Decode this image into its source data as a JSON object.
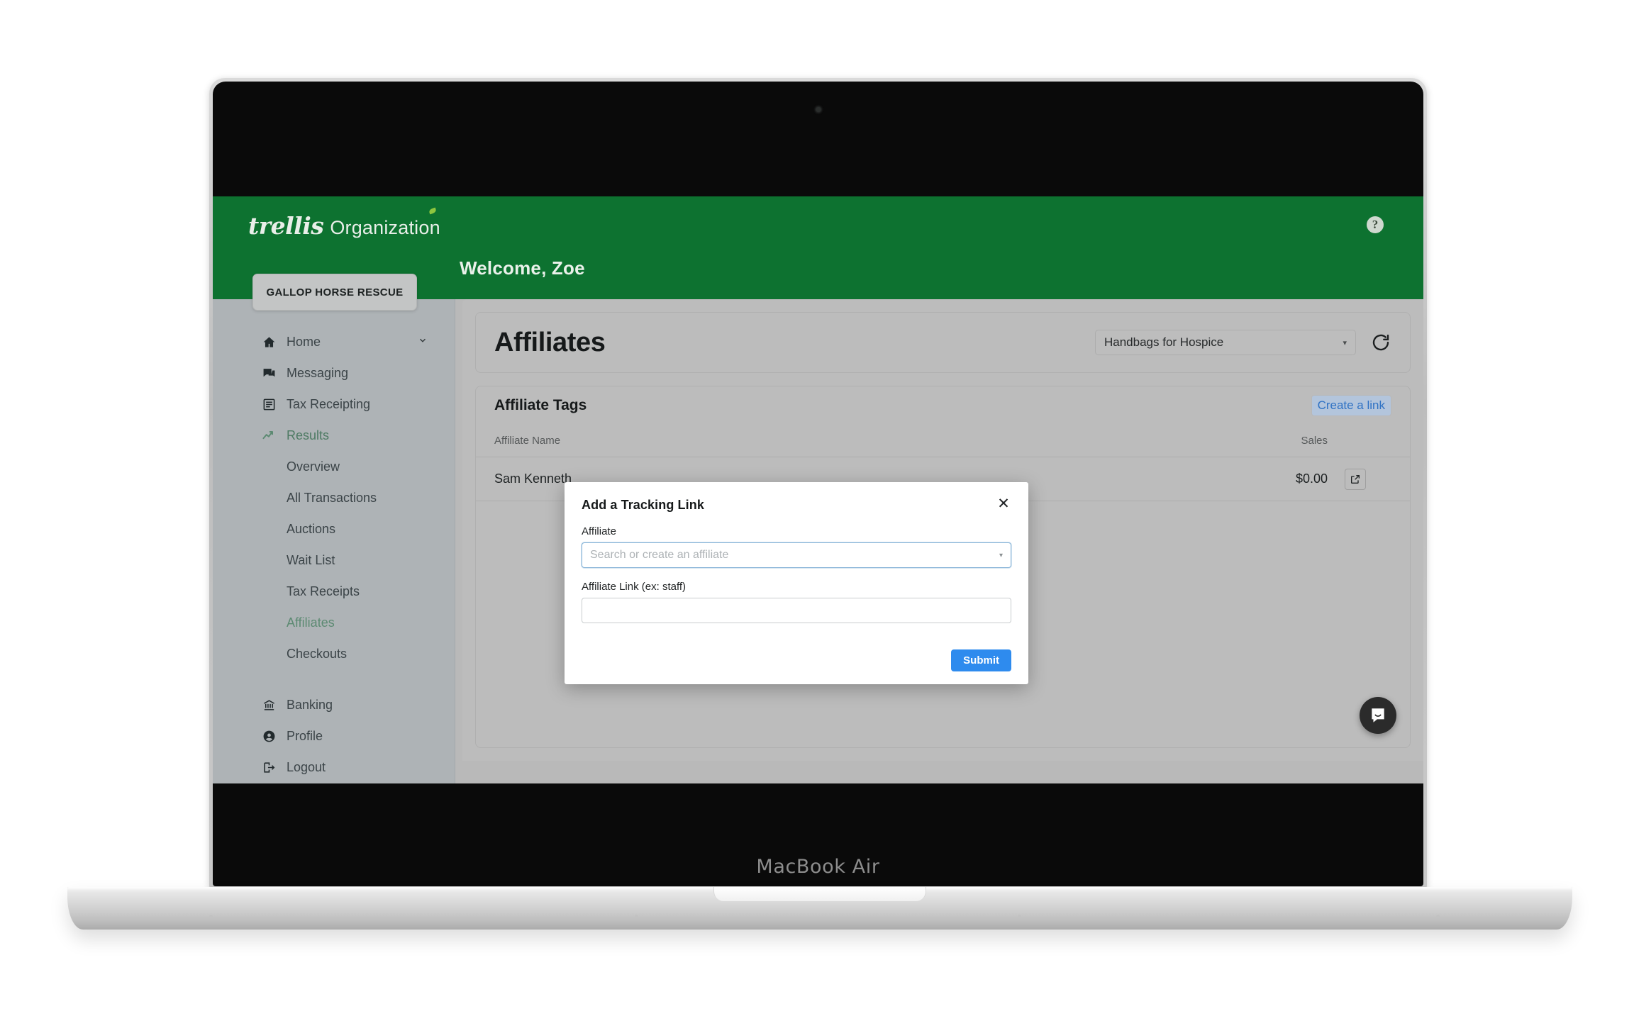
{
  "device": {
    "model_label": "MacBook Air"
  },
  "header": {
    "brand_logo": "trellis",
    "brand_sub": "Organization",
    "welcome": "Welcome, Zoe",
    "help_glyph": "?",
    "green": "#0d7230"
  },
  "sidebar": {
    "org_button": "GALLOP HORSE RESCUE",
    "items": [
      {
        "label": "Home",
        "icon": "home-icon",
        "chevron": "⌄",
        "active": false
      },
      {
        "label": "Messaging",
        "icon": "chat-icon",
        "active": false
      },
      {
        "label": "Tax Receipting",
        "icon": "receipt-icon",
        "active": false
      },
      {
        "label": "Results",
        "icon": "trend-up-icon",
        "active": true
      }
    ],
    "sub_items": [
      {
        "label": "Overview",
        "active": false
      },
      {
        "label": "All Transactions",
        "active": false
      },
      {
        "label": "Auctions",
        "active": false
      },
      {
        "label": "Wait List",
        "active": false
      },
      {
        "label": "Tax Receipts",
        "active": false
      },
      {
        "label": "Affiliates",
        "active": true
      },
      {
        "label": "Checkouts",
        "active": false
      }
    ],
    "bottom_items": [
      {
        "label": "Banking",
        "icon": "bank-icon"
      },
      {
        "label": "Profile",
        "icon": "person-circle-icon"
      },
      {
        "label": "Logout",
        "icon": "logout-icon"
      }
    ]
  },
  "main": {
    "page_title": "Affiliates",
    "event_select": {
      "value": "Handbags for Hospice",
      "caret": "▾"
    },
    "refresh_icon": "refresh-icon",
    "table": {
      "section_title": "Affiliate Tags",
      "create_link_label": "Create a link",
      "columns": [
        "Affiliate Name",
        "Sales"
      ],
      "rows": [
        {
          "affiliate_name": "Sam Kenneth",
          "sales": "$0.00",
          "action_icon": "external-link-icon"
        }
      ]
    },
    "chat_icon": "chat-bubble-icon"
  },
  "modal": {
    "title": "Add a Tracking Link",
    "close_glyph": "✕",
    "affiliate_label": "Affiliate",
    "affiliate_placeholder": "Search or create an affiliate",
    "affiliate_value": "",
    "affiliate_caret": "▾",
    "link_label": "Affiliate Link (ex: staff)",
    "link_placeholder": "",
    "link_value": "",
    "submit_label": "Submit",
    "submit_color": "#2e8bee"
  }
}
